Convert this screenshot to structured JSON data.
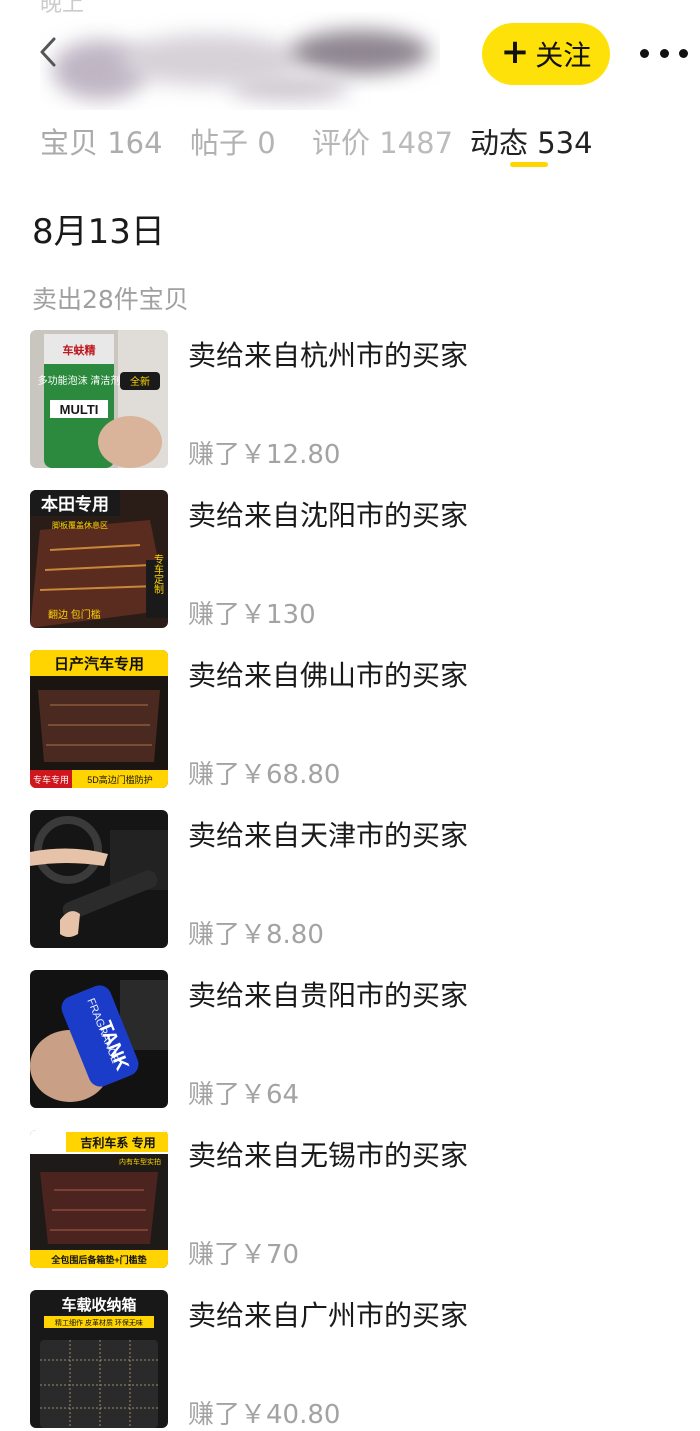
{
  "header": {
    "follow_label": "关注",
    "follow_plus": "+",
    "status_ghost": "晚上"
  },
  "tabs": [
    {
      "label": "宝贝 164"
    },
    {
      "label": "帖子 0"
    },
    {
      "label": "评价 1487"
    },
    {
      "label": "动态 534",
      "active": true
    }
  ],
  "feed": {
    "date": "8月13日",
    "summary": "卖出28件宝贝",
    "items": [
      {
        "title": "卖给来自杭州市的买家",
        "price": "赚了￥12.80",
        "thumb": {
          "brand": "车蚨精",
          "label": "多功能泡沫 清洁剂",
          "sub": "MULTI",
          "badge": "全新"
        }
      },
      {
        "title": "卖给来自沈阳市的买家",
        "price": "赚了￥130",
        "thumb": {
          "brand": "本田专用",
          "label": "脚板覆盖休息区",
          "side": "专车定制",
          "corner": "翻边 包门槛"
        }
      },
      {
        "title": "卖给来自佛山市的买家",
        "price": "赚了￥68.80",
        "thumb": {
          "brand": "日产汽车专用",
          "label": "专车专用",
          "sub": "5D高边门槛防护"
        }
      },
      {
        "title": "卖给来自天津市的买家",
        "price": "赚了￥8.80",
        "thumb": {}
      },
      {
        "title": "卖给来自贵阳市的买家",
        "price": "赚了￥64",
        "thumb": {
          "brand": "TANK",
          "label": "FRAGRANCE"
        }
      },
      {
        "title": "卖给来自无锡市的买家",
        "price": "赚了￥70",
        "thumb": {
          "brand": "吉利车系 专用",
          "label": "内有车型实拍",
          "sub": "全包围后备箱垫+门槛垫"
        }
      },
      {
        "title": "卖给来自广州市的买家",
        "price": "赚了￥40.80",
        "thumb": {
          "brand": "车载收纳箱",
          "label": "精工细作 皮革材质 环保无味"
        }
      }
    ]
  },
  "colors": {
    "accent": "#ffe10a",
    "underline": "#ffd600",
    "muted": "#a3a3a3",
    "text": "#1a1a1a"
  }
}
